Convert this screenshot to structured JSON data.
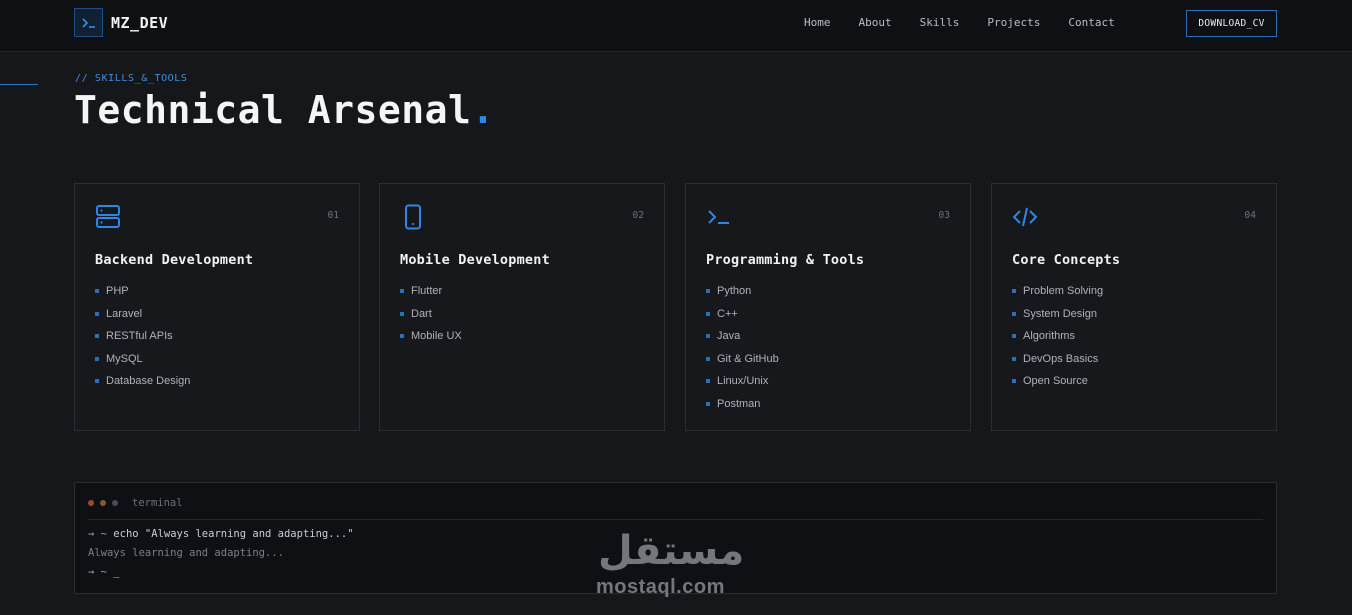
{
  "nav": {
    "logo_text": "MZ_DEV",
    "logo_icon": "terminal-prompt-icon",
    "links": [
      "Home",
      "About",
      "Skills",
      "Projects",
      "Contact"
    ],
    "cta": "DOWNLOAD_CV"
  },
  "section": {
    "label": "// SKILLS_&_TOOLS",
    "title": "Technical Arsenal",
    "title_dot": "."
  },
  "cards": [
    {
      "num": "01",
      "icon": "server-icon",
      "title": "Backend Development",
      "items": [
        "PHP",
        "Laravel",
        "RESTful APIs",
        "MySQL",
        "Database Design"
      ]
    },
    {
      "num": "02",
      "icon": "mobile-phone-icon",
      "title": "Mobile Development",
      "items": [
        "Flutter",
        "Dart",
        "Mobile UX"
      ]
    },
    {
      "num": "03",
      "icon": "terminal-icon",
      "title": "Programming & Tools",
      "items": [
        "Python",
        "C++",
        "Java",
        "Git & GitHub",
        "Linux/Unix",
        "Postman"
      ]
    },
    {
      "num": "04",
      "icon": "code-icon",
      "title": "Core Concepts",
      "items": [
        "Problem Solving",
        "System Design",
        "Algorithms",
        "DevOps Basics",
        "Open Source"
      ]
    }
  ],
  "terminal": {
    "title": "terminal",
    "prompt": "→ ~",
    "command": "echo \"Always learning and adapting...\"",
    "output": "Always learning and adapting...",
    "cursor": "_"
  },
  "watermark": {
    "arabic": "مستقل",
    "latin": "mostaql.com"
  },
  "colors": {
    "accent": "#2f86e6",
    "background": "#16171b",
    "nav_bg": "#0f1014"
  }
}
